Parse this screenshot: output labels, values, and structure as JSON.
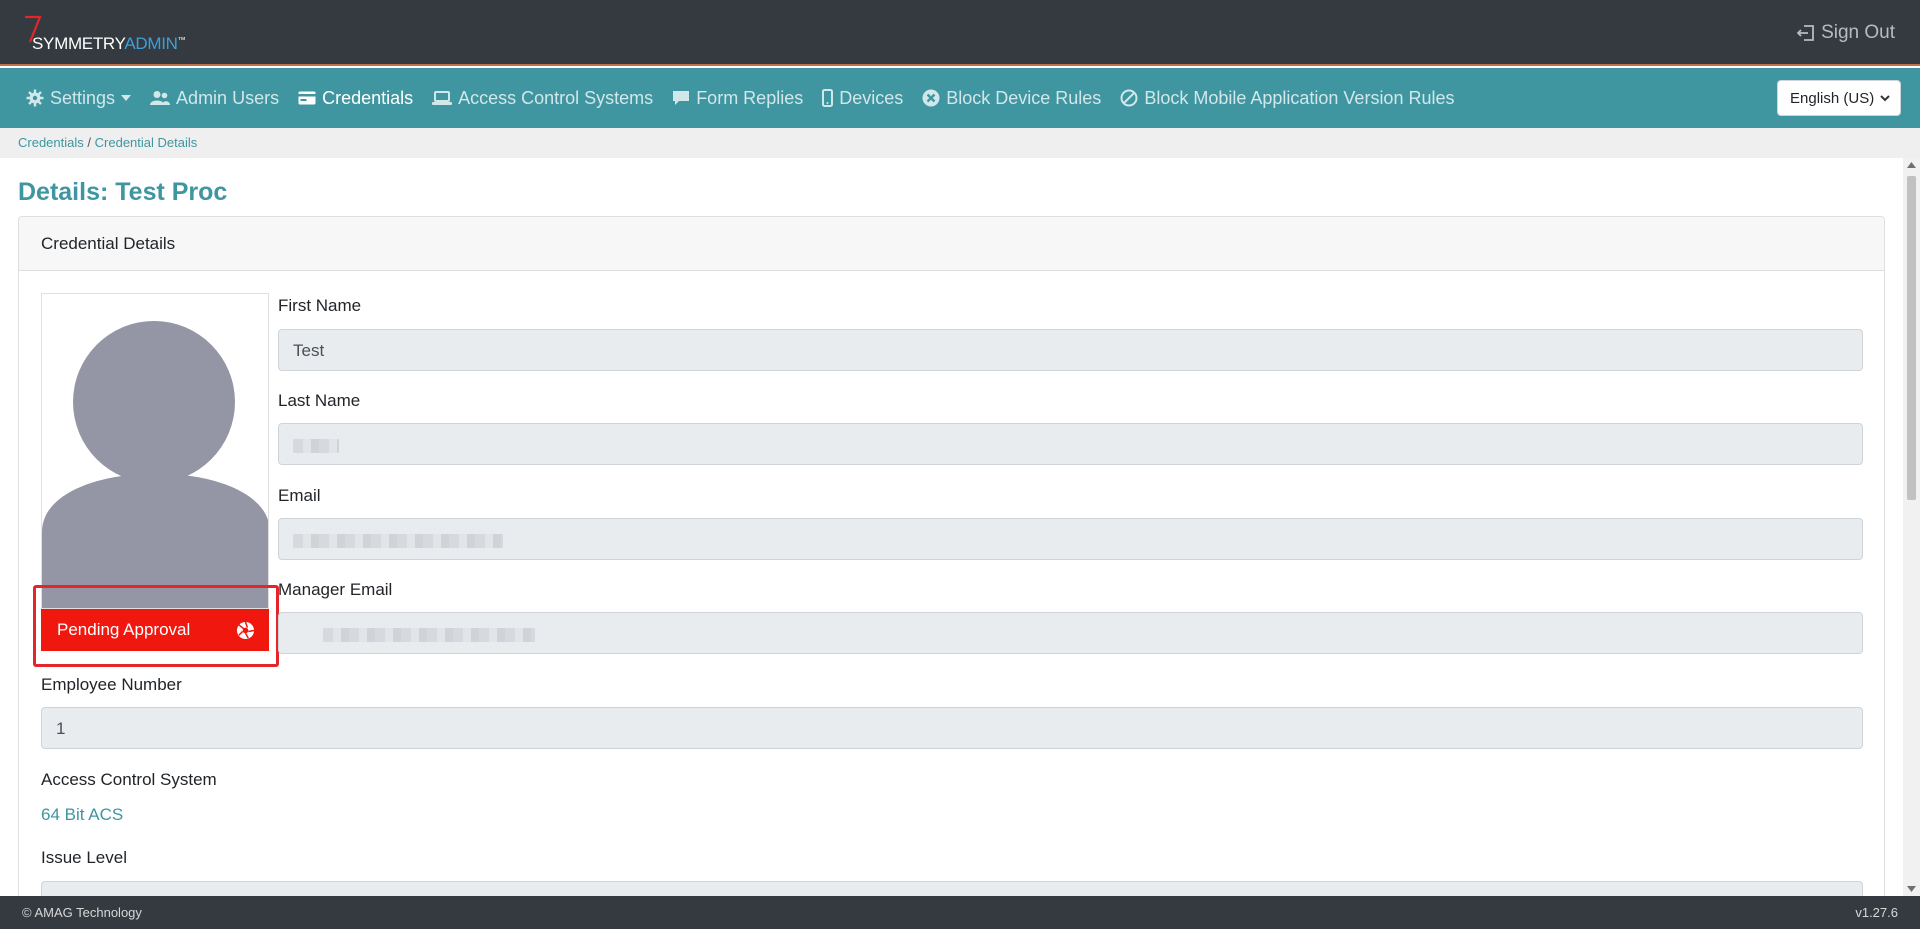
{
  "header": {
    "logo_primary": "SYMMETRY",
    "logo_secondary": "ADMIN",
    "logo_mark": "™",
    "signout_label": "Sign Out"
  },
  "nav": {
    "items": [
      {
        "label": "Settings",
        "icon": "gear-icon"
      },
      {
        "label": "Admin Users",
        "icon": "users-icon"
      },
      {
        "label": "Credentials",
        "icon": "id-card-icon"
      },
      {
        "label": "Access Control Systems",
        "icon": "laptop-icon"
      },
      {
        "label": "Form Replies",
        "icon": "comment-icon"
      },
      {
        "label": "Devices",
        "icon": "mobile-icon"
      },
      {
        "label": "Block Device Rules",
        "icon": "times-circle-icon"
      },
      {
        "label": "Block Mobile Application Version Rules",
        "icon": "ban-icon"
      }
    ],
    "language": "English (US)"
  },
  "breadcrumb": {
    "root": "Credentials",
    "separator": "/",
    "current": "Credential Details"
  },
  "page": {
    "title": "Details: Test Proc"
  },
  "card": {
    "header": "Credential Details",
    "status": "Pending Approval",
    "fields": {
      "first_name_label": "First Name",
      "first_name_value": "Test",
      "last_name_label": "Last Name",
      "email_label": "Email",
      "manager_email_label": "Manager Email",
      "employee_number_label": "Employee Number",
      "employee_number_value": "1",
      "acs_label": "Access Control System",
      "acs_value": "64 Bit ACS",
      "issue_level_label": "Issue Level"
    }
  },
  "footer": {
    "copyright": "© AMAG Technology",
    "version": "v1.27.6"
  },
  "colors": {
    "topbar": "#343a40",
    "nav": "#3f96a0",
    "accent": "#3f96a0",
    "pending": "#f0170f",
    "annotation": "#e4262b"
  }
}
